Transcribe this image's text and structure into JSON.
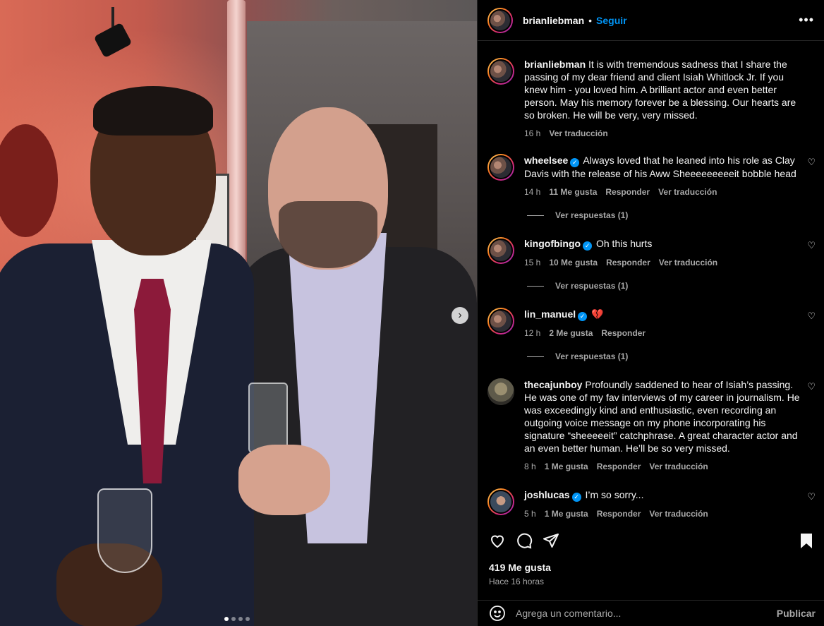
{
  "post": {
    "author": "brianliebman",
    "follow_label": "Seguir",
    "more_icon": "more-options-icon",
    "caption": "It is with tremendous sadness that I share the passing of my dear friend and client Isiah Whitlock Jr. If you knew him - you loved him. A brilliant actor and even better person. May his memory forever be a blessing. Our hearts are so broken. He will be very, very missed.",
    "caption_time": "16 h",
    "caption_translate": "Ver traducción",
    "likes": "419 Me gusta",
    "posted_ago": "Hace 16 horas",
    "carousel": {
      "current": 1,
      "total": 4
    }
  },
  "comments": [
    {
      "user": "wheelsee",
      "verified": true,
      "text": "Always loved that he leaned into his role as Clay Davis with the release of his Aww Sheeeeeeeeeit bobble head",
      "time": "14 h",
      "likes": "11 Me gusta",
      "reply": "Responder",
      "translate": "Ver traducción",
      "replies": "Ver respuestas (1)"
    },
    {
      "user": "kingofbingo",
      "verified": true,
      "text": "Oh this hurts",
      "time": "15 h",
      "likes": "10 Me gusta",
      "reply": "Responder",
      "translate": "Ver traducción",
      "replies": "Ver respuestas (1)"
    },
    {
      "user": "lin_manuel",
      "verified": true,
      "text": "💔",
      "time": "12 h",
      "likes": "2 Me gusta",
      "reply": "Responder",
      "replies": "Ver respuestas (1)"
    },
    {
      "user": "thecajunboy",
      "verified": false,
      "text": "Profoundly saddened to hear of Isiah’s passing. He was one of my fav interviews of my career in journalism. He was exceedingly kind and enthusiastic, even recording an outgoing voice message on my phone incorporating his signature “sheeeeeit” catchphrase. A great character actor and an even better human. He’ll be so very missed.",
      "time": "8 h",
      "likes": "1 Me gusta",
      "reply": "Responder",
      "translate": "Ver traducción"
    },
    {
      "user": "joshlucas",
      "verified": true,
      "text": "I’m so sorry...",
      "time": "5 h",
      "likes": "1 Me gusta",
      "reply": "Responder",
      "translate": "Ver traducción"
    }
  ],
  "composer": {
    "placeholder": "Agrega un comentario...",
    "post_label": "Publicar"
  },
  "icons": [
    "heart-icon",
    "comment-icon",
    "share-icon",
    "bookmark-icon",
    "emoji-icon",
    "verified-icon",
    "chevron-right-icon"
  ],
  "colors": {
    "accent": "#0095f6",
    "background": "#000000",
    "muted": "#a8a8a8"
  }
}
